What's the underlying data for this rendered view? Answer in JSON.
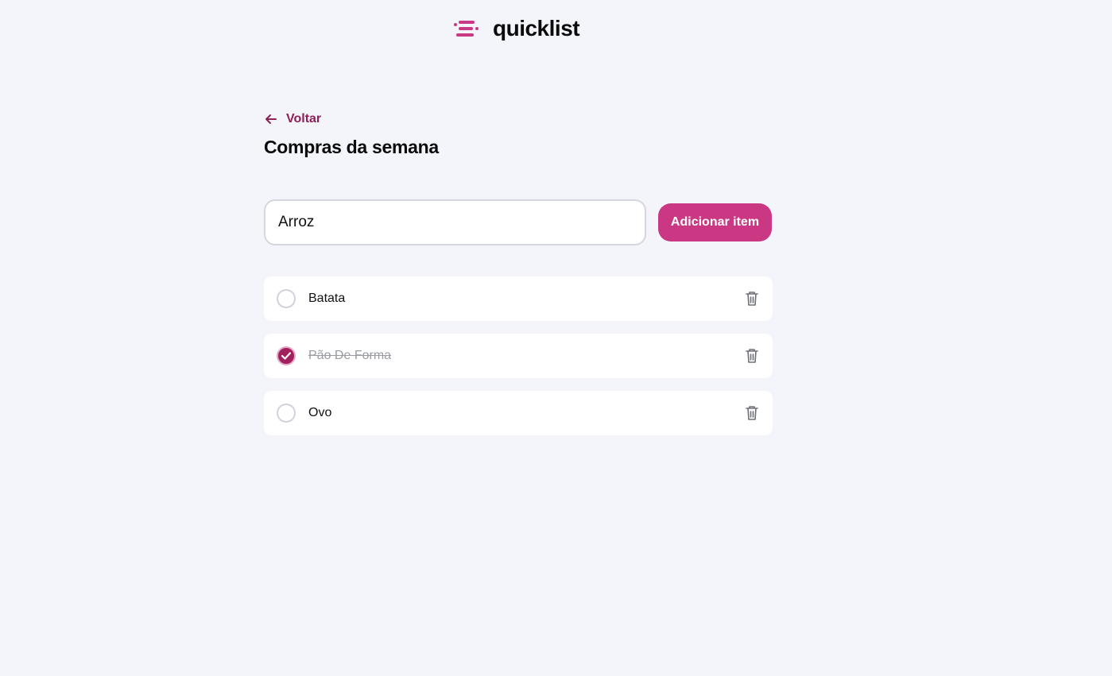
{
  "header": {
    "brand": "quicklist",
    "logo_icon": "list-lines-icon",
    "accent_color": "#ca3884"
  },
  "nav": {
    "back_label": "Voltar",
    "back_icon": "arrow-left-icon"
  },
  "page": {
    "title": "Compras da semana"
  },
  "add_form": {
    "input_value": "Arroz",
    "button_label": "Adicionar item"
  },
  "items": [
    {
      "label": "Batata",
      "checked": false
    },
    {
      "label": "Pão De Forma",
      "checked": true
    },
    {
      "label": "Ovo",
      "checked": false
    }
  ],
  "colors": {
    "background": "#f4f5fa",
    "primary": "#ca3884",
    "checked": "#a3205f",
    "back_link": "#8c2158"
  }
}
